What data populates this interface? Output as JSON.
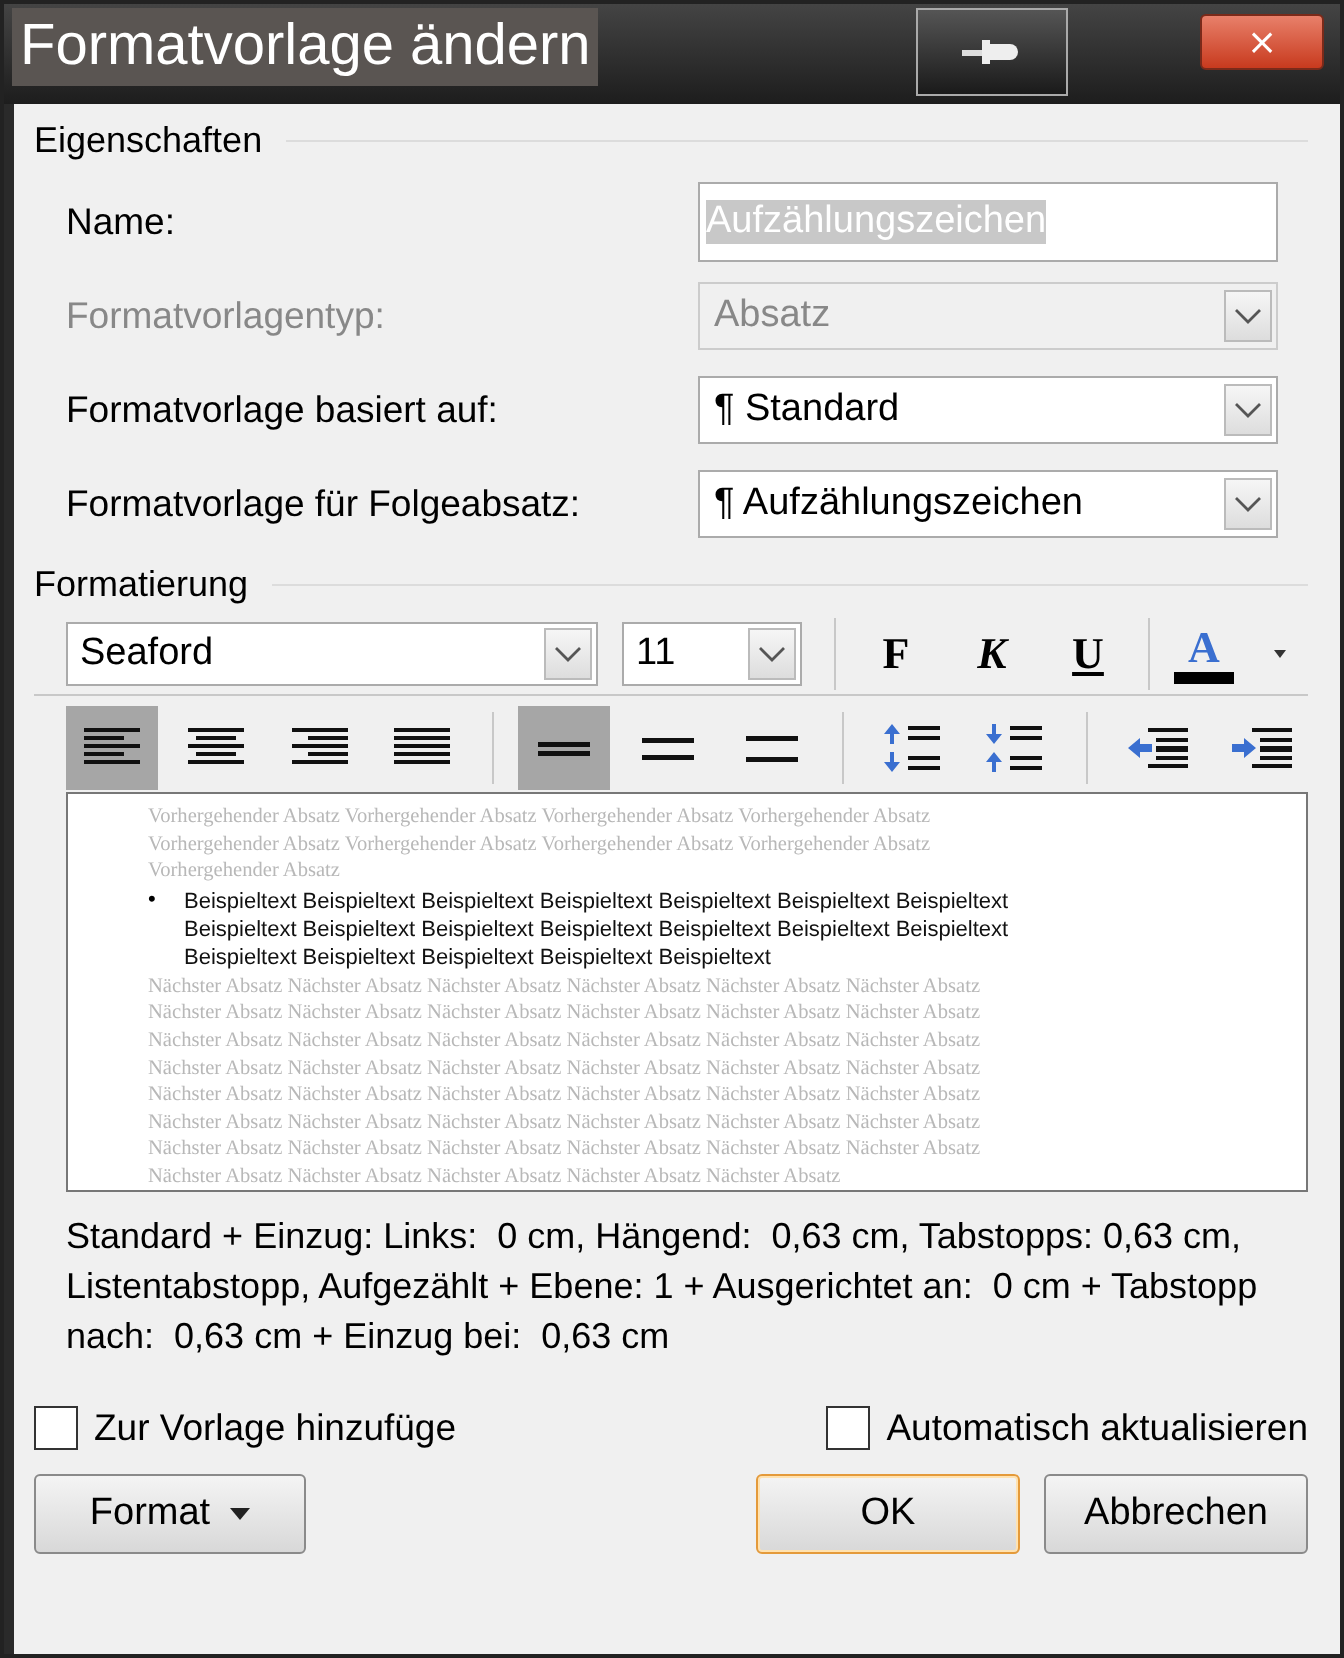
{
  "window": {
    "title": "Formatvorlage ändern",
    "close": "×"
  },
  "properties": {
    "heading": "Eigenschaften",
    "fields": [
      {
        "kind": "text",
        "label": "Name:",
        "value": "Aufzählungszeichen",
        "disabled": false
      },
      {
        "kind": "combo",
        "label": "Formatvorlagentyp:",
        "value": "Absatz",
        "disabled": true
      },
      {
        "kind": "combo",
        "label": "Formatvorlage basiert auf:",
        "value": "¶ Standard",
        "disabled": false
      },
      {
        "kind": "combo",
        "label": "Formatvorlage für Folgeabsatz:",
        "value": "¶ Aufzählungszeichen",
        "disabled": false
      }
    ]
  },
  "formatting": {
    "heading": "Formatierung",
    "font": "Seaford",
    "size": "11",
    "style_buttons": [
      {
        "kind": "bold",
        "label": "F"
      },
      {
        "kind": "italic",
        "label": "K"
      },
      {
        "kind": "underline",
        "label": "U"
      },
      {
        "kind": "color",
        "label": "A"
      }
    ],
    "alignment": [
      {
        "kind": "left",
        "selected": true
      },
      {
        "kind": "center",
        "selected": false
      },
      {
        "kind": "right",
        "selected": false
      },
      {
        "kind": "justify",
        "selected": false
      }
    ],
    "spacing": [
      {
        "kind": "single",
        "selected": true
      },
      {
        "kind": "onehalf",
        "selected": false
      },
      {
        "kind": "double",
        "selected": false
      }
    ],
    "paragraph_spacing": [
      {
        "kind": "increase"
      },
      {
        "kind": "decrease"
      }
    ],
    "indent": [
      {
        "kind": "decrease"
      },
      {
        "kind": "increase"
      }
    ]
  },
  "preview": {
    "previous": [
      "Vorhergehender Absatz Vorhergehender Absatz Vorhergehender Absatz Vorhergehender Absatz",
      "Vorhergehender Absatz Vorhergehender Absatz Vorhergehender Absatz Vorhergehender Absatz",
      "Vorhergehender Absatz"
    ],
    "bullet": "•",
    "sample": [
      "Beispieltext Beispieltext Beispieltext Beispieltext Beispieltext Beispieltext Beispieltext",
      "Beispieltext Beispieltext Beispieltext Beispieltext Beispieltext Beispieltext Beispieltext",
      "Beispieltext Beispieltext Beispieltext Beispieltext Beispieltext"
    ],
    "next": [
      "Nächster Absatz Nächster Absatz Nächster Absatz Nächster Absatz Nächster Absatz Nächster Absatz",
      "Nächster Absatz Nächster Absatz Nächster Absatz Nächster Absatz Nächster Absatz Nächster Absatz",
      "Nächster Absatz Nächster Absatz Nächster Absatz Nächster Absatz Nächster Absatz Nächster Absatz",
      "Nächster Absatz Nächster Absatz Nächster Absatz Nächster Absatz Nächster Absatz Nächster Absatz",
      "Nächster Absatz Nächster Absatz Nächster Absatz Nächster Absatz Nächster Absatz Nächster Absatz",
      "Nächster Absatz Nächster Absatz Nächster Absatz Nächster Absatz Nächster Absatz Nächster Absatz",
      "Nächster Absatz Nächster Absatz Nächster Absatz Nächster Absatz Nächster Absatz Nächster Absatz",
      "Nächster Absatz Nächster Absatz Nächster Absatz Nächster Absatz Nächster Absatz"
    ]
  },
  "description": "Standard + Einzug: Links:  0 cm, Hängend:  0,63 cm, Tabstopps: 0,63 cm, Listentabstopp, Aufgezählt + Ebene: 1 + Ausgerichtet an:  0 cm + Tabstopp nach:  0,63 cm + Einzug bei:  0,63 cm",
  "options": [
    {
      "label": "Zur Vorlage hinzufüge",
      "checked": false
    },
    {
      "label": "Automatisch aktualisieren",
      "checked": false
    }
  ],
  "buttons": [
    {
      "kind": "menu",
      "label": "Format"
    },
    {
      "kind": "default",
      "label": "OK"
    },
    {
      "kind": "normal",
      "label": "Abbrechen"
    }
  ]
}
